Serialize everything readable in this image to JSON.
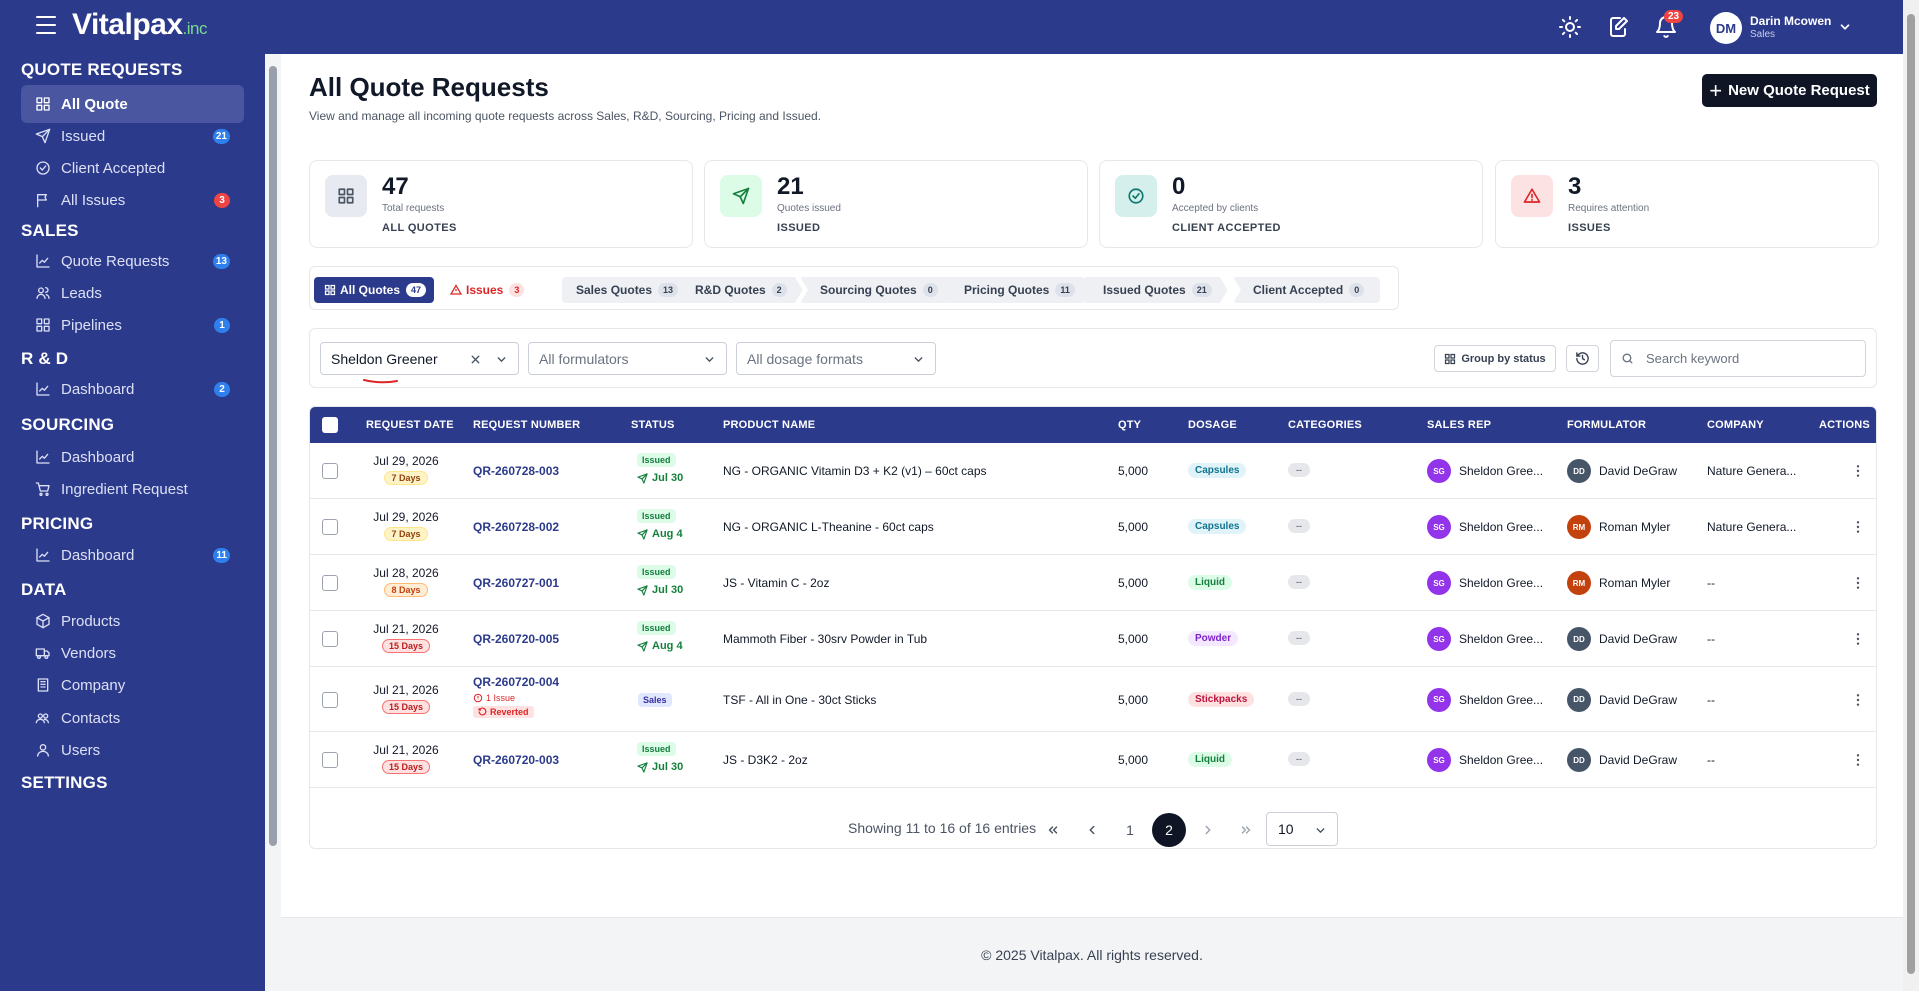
{
  "topbar": {
    "logo_main": "Vitalpax",
    "logo_suffix": ".inc",
    "notification_count": "23",
    "user_initials": "DM",
    "user_name": "Darin Mcowen",
    "user_role": "Sales"
  },
  "sidebar": {
    "sections": [
      {
        "title": "QUOTE REQUESTS",
        "items": [
          {
            "label": "All Quote",
            "icon": "grid-icon",
            "active": true
          },
          {
            "label": "Issued",
            "icon": "send-icon",
            "badge": "21",
            "badge_color": "blue"
          },
          {
            "label": "Client Accepted",
            "icon": "check-circle-icon"
          },
          {
            "label": "All Issues",
            "icon": "flag-icon",
            "badge": "3",
            "badge_color": "red"
          }
        ]
      },
      {
        "title": "SALES",
        "items": [
          {
            "label": "Quote Requests",
            "icon": "chart-icon",
            "badge": "13",
            "badge_color": "blue"
          },
          {
            "label": "Leads",
            "icon": "users-icon"
          },
          {
            "label": "Pipelines",
            "icon": "grid-icon",
            "badge": "1",
            "badge_color": "blue"
          }
        ]
      },
      {
        "title": "R & D",
        "items": [
          {
            "label": "Dashboard",
            "icon": "chart-icon",
            "badge": "2",
            "badge_color": "blue"
          }
        ]
      },
      {
        "title": "SOURCING",
        "items": [
          {
            "label": "Dashboard",
            "icon": "chart-icon"
          },
          {
            "label": "Ingredient Request",
            "icon": "cart-icon"
          }
        ]
      },
      {
        "title": "PRICING",
        "items": [
          {
            "label": "Dashboard",
            "icon": "chart-icon",
            "badge": "11",
            "badge_color": "blue"
          }
        ]
      },
      {
        "title": "DATA",
        "items": [
          {
            "label": "Products",
            "icon": "box-icon"
          },
          {
            "label": "Vendors",
            "icon": "truck-icon"
          },
          {
            "label": "Company",
            "icon": "building-icon"
          },
          {
            "label": "Contacts",
            "icon": "contacts-icon"
          },
          {
            "label": "Users",
            "icon": "user-icon"
          }
        ]
      },
      {
        "title": "SETTINGS",
        "items": []
      }
    ]
  },
  "page": {
    "title": "All Quote Requests",
    "subtitle": "View and manage all incoming quote requests across Sales, R&D, Sourcing, Pricing and Issued.",
    "new_button": "New Quote Request"
  },
  "stats": [
    {
      "value": "47",
      "label": "Total requests",
      "caption": "ALL QUOTES",
      "icon": "grid-icon",
      "color": "#e8eaf2"
    },
    {
      "value": "21",
      "label": "Quotes issued",
      "caption": "ISSUED",
      "icon": "send-icon",
      "color": "#dcfce7"
    },
    {
      "value": "0",
      "label": "Accepted by clients",
      "caption": "CLIENT ACCEPTED",
      "icon": "check-circle-icon",
      "color": "#d5f0ec"
    },
    {
      "value": "3",
      "label": "Requires attention",
      "caption": "ISSUES",
      "icon": "warning-icon",
      "color": "#fde2e4"
    }
  ],
  "tabs": [
    {
      "label": "All Quotes",
      "count": "47"
    },
    {
      "label": "Issues",
      "count": "3"
    },
    {
      "label": "Sales Quotes",
      "count": "13"
    },
    {
      "label": "R&D Quotes",
      "count": "2"
    },
    {
      "label": "Sourcing Quotes",
      "count": "0"
    },
    {
      "label": "Pricing Quotes",
      "count": "11"
    },
    {
      "label": "Issued Quotes",
      "count": "21"
    },
    {
      "label": "Client Accepted",
      "count": "0"
    }
  ],
  "filters": {
    "sales_rep": "Sheldon Greener",
    "formulators": "All formulators",
    "dosage": "All dosage formats",
    "group_by": "Group by status",
    "search_placeholder": "Search keyword"
  },
  "table": {
    "columns": [
      "REQUEST DATE",
      "REQUEST NUMBER",
      "STATUS",
      "PRODUCT NAME",
      "QTY",
      "DOSAGE",
      "CATEGORIES",
      "SALES REP",
      "FORMULATOR",
      "COMPANY",
      "ACTIONS"
    ],
    "rows": [
      {
        "date": "Jul 29, 2026",
        "days": "7 Days",
        "days_color": "yellow",
        "number": "QR-260728-003",
        "status": "Issued",
        "status_date": "Jul 30",
        "product": "NG - ORGANIC Vitamin D3 + K2 (v1) – 60ct caps",
        "qty": "5,000",
        "dosage": "Capsules",
        "categories": "--",
        "sales_rep": "Sheldon Gree...",
        "sales_rep_initials": "SG",
        "formulator": "David DeGraw",
        "formulator_initials": "DD",
        "company": "Nature Genera..."
      },
      {
        "date": "Jul 29, 2026",
        "days": "7 Days",
        "days_color": "yellow",
        "number": "QR-260728-002",
        "status": "Issued",
        "status_date": "Aug 4",
        "product": "NG - ORGANIC L-Theanine - 60ct caps",
        "qty": "5,000",
        "dosage": "Capsules",
        "categories": "--",
        "sales_rep": "Sheldon Gree...",
        "sales_rep_initials": "SG",
        "formulator": "Roman Myler",
        "formulator_initials": "RM",
        "company": "Nature Genera..."
      },
      {
        "date": "Jul 28, 2026",
        "days": "8 Days",
        "days_color": "orange",
        "number": "QR-260727-001",
        "status": "Issued",
        "status_date": "Jul 30",
        "product": "JS - Vitamin C - 2oz",
        "qty": "5,000",
        "dosage": "Liquid",
        "categories": "--",
        "sales_rep": "Sheldon Gree...",
        "sales_rep_initials": "SG",
        "formulator": "Roman Myler",
        "formulator_initials": "RM",
        "company": "--"
      },
      {
        "date": "Jul 21, 2026",
        "days": "15 Days",
        "days_color": "red",
        "number": "QR-260720-005",
        "status": "Issued",
        "status_date": "Aug 4",
        "product": "Mammoth Fiber - 30srv Powder in Tub",
        "qty": "5,000",
        "dosage": "Powder",
        "categories": "--",
        "sales_rep": "Sheldon Gree...",
        "sales_rep_initials": "SG",
        "formulator": "David DeGraw",
        "formulator_initials": "DD",
        "company": "--"
      },
      {
        "date": "Jul 21, 2026",
        "days": "15 Days",
        "days_color": "red",
        "number": "QR-260720-004",
        "issue_text": "1 Issue",
        "reverted_text": "Reverted",
        "status": "Sales",
        "status_date": "",
        "product": "TSF - All in One - 30ct Sticks",
        "qty": "5,000",
        "dosage": "Stickpacks",
        "categories": "--",
        "sales_rep": "Sheldon Gree...",
        "sales_rep_initials": "SG",
        "formulator": "David DeGraw",
        "formulator_initials": "DD",
        "company": "--"
      },
      {
        "date": "Jul 21, 2026",
        "days": "15 Days",
        "days_color": "red",
        "number": "QR-260720-003",
        "status": "Issued",
        "status_date": "Jul 30",
        "product": "JS - D3K2 - 2oz",
        "qty": "5,000",
        "dosage": "Liquid",
        "categories": "--",
        "sales_rep": "Sheldon Gree...",
        "sales_rep_initials": "SG",
        "formulator": "David DeGraw",
        "formulator_initials": "DD",
        "company": "--"
      }
    ]
  },
  "pagination": {
    "info": "Showing 11 to 16 of 16 entries",
    "pages": [
      "1",
      "2"
    ],
    "current": "2",
    "page_size": "10"
  },
  "footer": "© 2025 Vitalpax. All rights reserved."
}
